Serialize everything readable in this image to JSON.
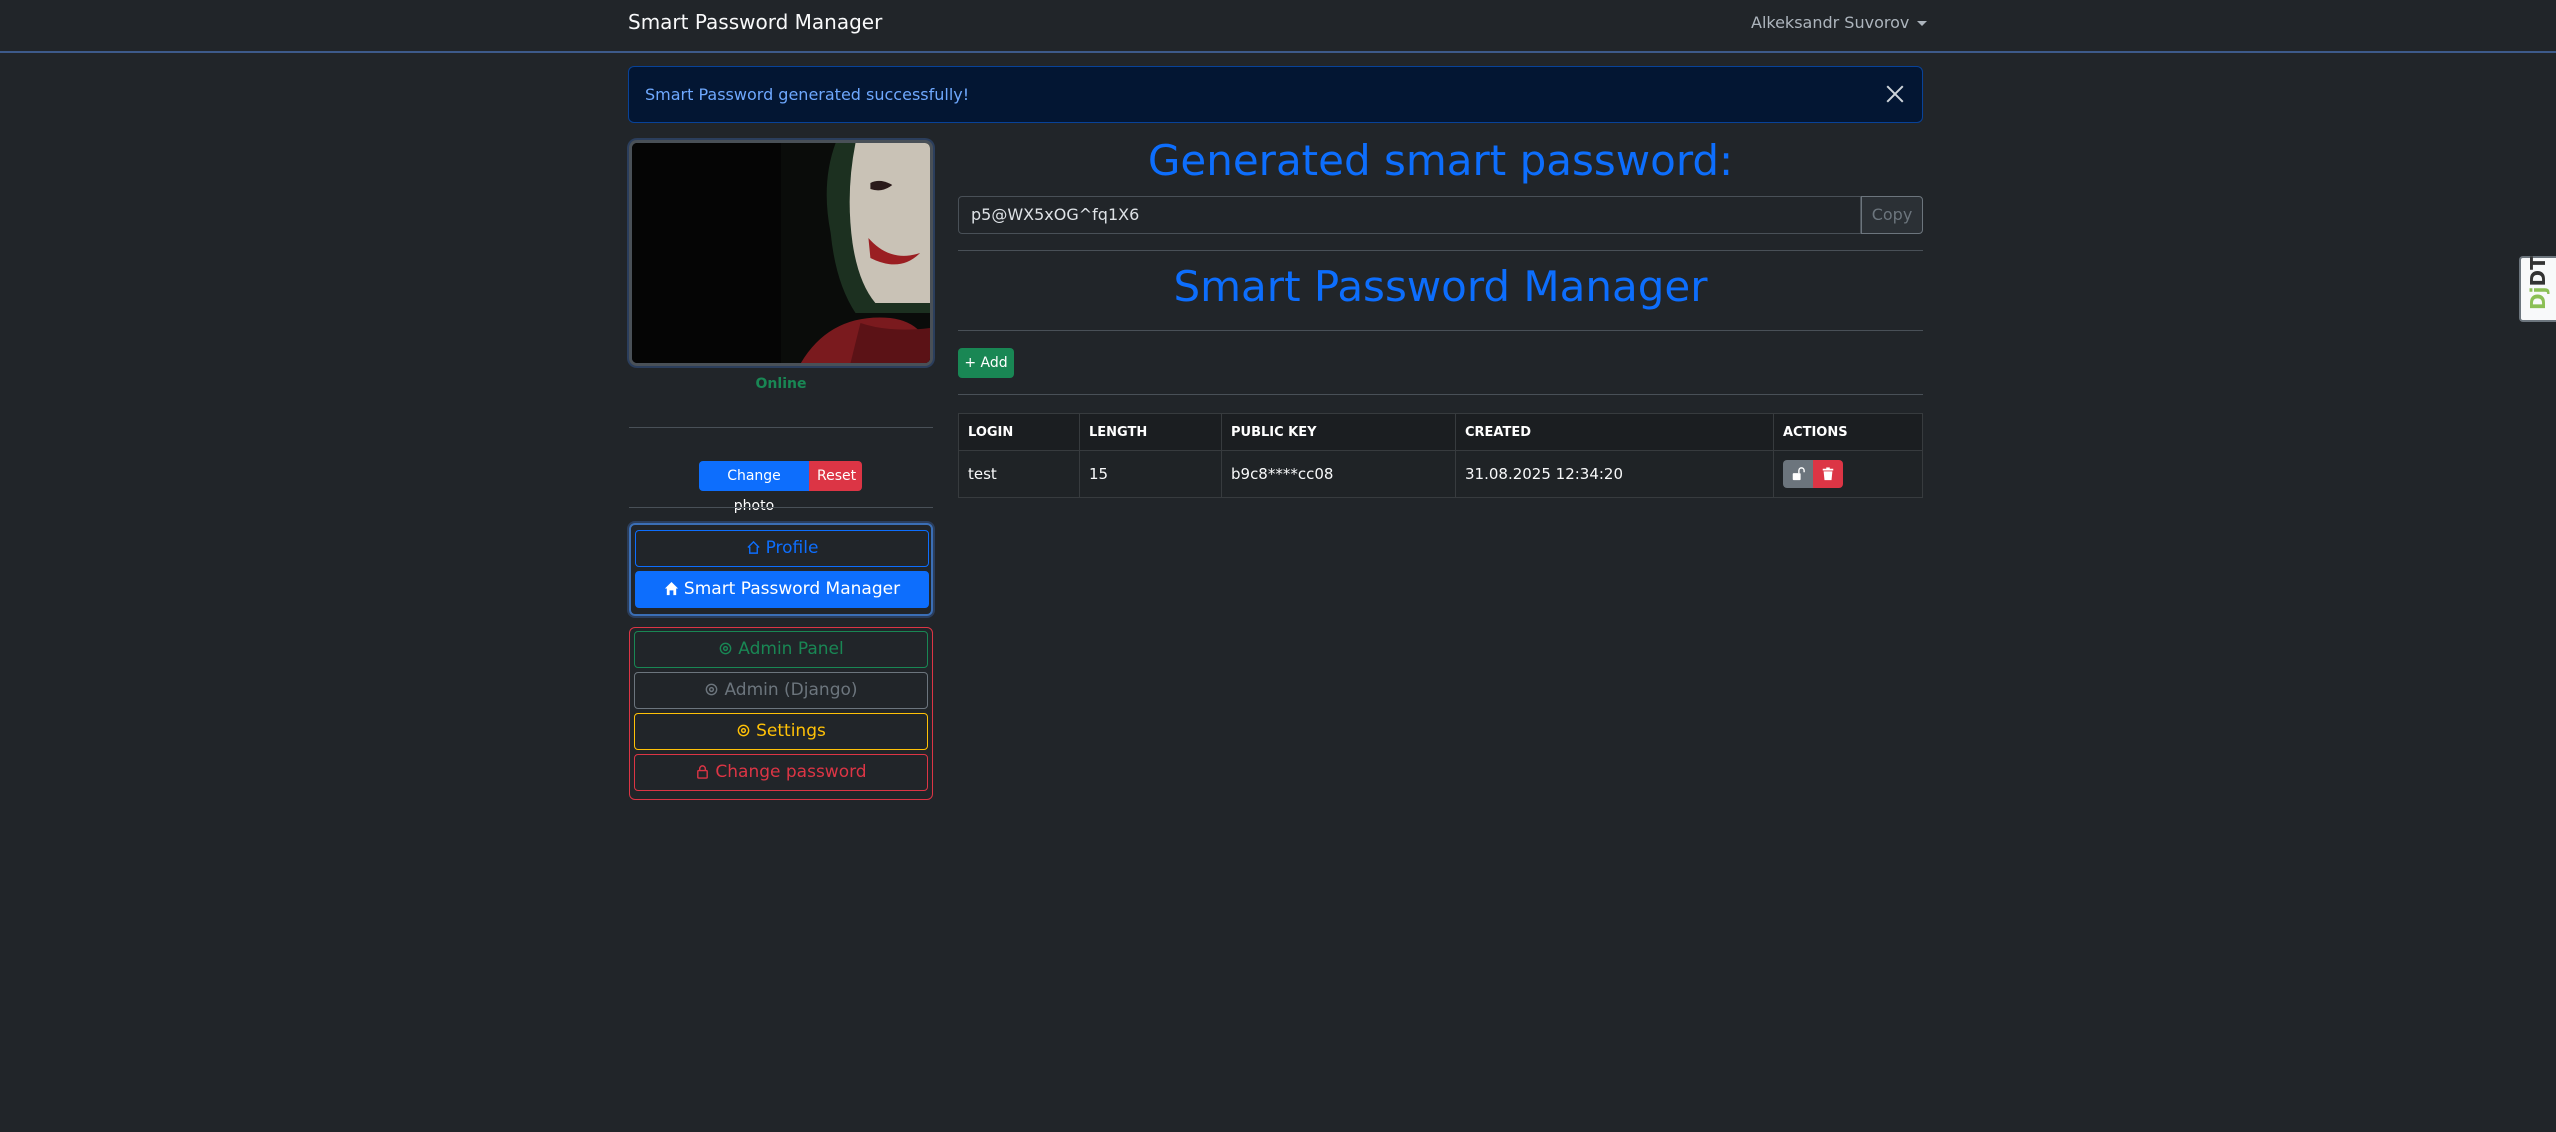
{
  "navbar": {
    "brand": "Smart Password Manager",
    "user": "Alkeksandr Suvorov"
  },
  "alert": {
    "message": "Smart Password generated successfully!"
  },
  "sidebar": {
    "status": "Online",
    "change_photo": "Change photo",
    "reset": "Reset",
    "nav": {
      "profile": "Profile",
      "spm": "Smart Password Manager",
      "admin_panel": "Admin Panel",
      "admin_django": "Admin (Django)",
      "settings": "Settings",
      "change_password": "Change password"
    }
  },
  "main": {
    "generated_heading": "Generated smart password:",
    "generated_password": "p5@WX5xOG^fq1X6",
    "copy_label": "Copy",
    "manager_heading": "Smart Password Manager",
    "add_label": "+ Add",
    "table": {
      "headers": [
        "LOGIN",
        "LENGTH",
        "PUBLIC KEY",
        "CREATED",
        "ACTIONS"
      ],
      "rows": [
        {
          "login": "test",
          "length": "15",
          "public_key": "b9c8****cc08",
          "created": "31.08.2025 12:34:20"
        }
      ]
    }
  },
  "debug_toolbar": {
    "label_prefix": "Dj",
    "label_suffix": "DT"
  },
  "colors": {
    "primary": "#0d6efd",
    "success": "#198754",
    "danger": "#dc3545",
    "warning": "#ffc107",
    "background": "#212529"
  }
}
